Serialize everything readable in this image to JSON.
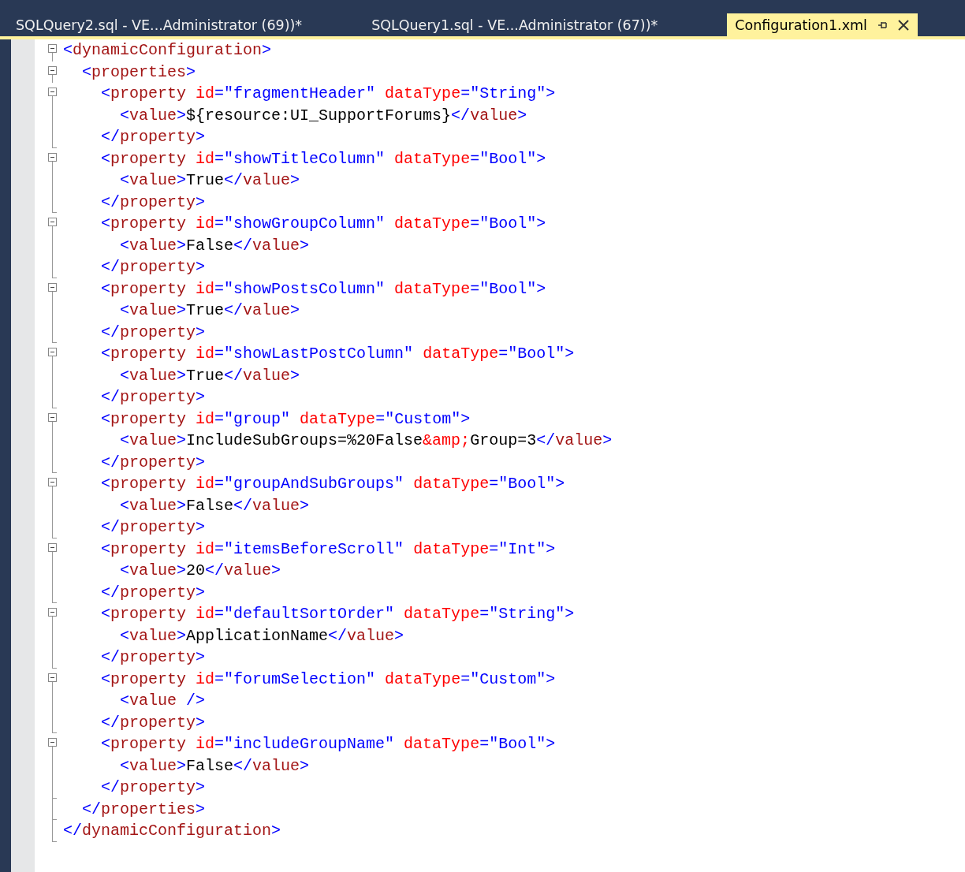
{
  "tabs": [
    {
      "label": "SQLQuery2.sql - VE...Administrator (69))*",
      "selected": false
    },
    {
      "label": "SQLQuery1.sql - VE...Administrator (67))*",
      "selected": false
    },
    {
      "label": "Configuration1.xml",
      "selected": true
    }
  ],
  "editor": {
    "lines": [
      {
        "kind": "start",
        "tokens": [
          {
            "kind": "punct",
            "text": "<"
          },
          {
            "kind": "tag",
            "text": "dynamicConfiguration"
          },
          {
            "kind": "punct",
            "text": ">"
          }
        ]
      },
      {
        "kind": "start",
        "tokens": [
          {
            "kind": "punct",
            "text": "  <"
          },
          {
            "kind": "tag",
            "text": "properties"
          },
          {
            "kind": "punct",
            "text": ">"
          }
        ]
      },
      {
        "kind": "start",
        "tokens": [
          {
            "kind": "punct",
            "text": "    <"
          },
          {
            "kind": "tag",
            "text": "property"
          },
          {
            "kind": "attr",
            "text": " id"
          },
          {
            "kind": "punct",
            "text": "=\""
          },
          {
            "kind": "value",
            "text": "fragmentHeader"
          },
          {
            "kind": "punct",
            "text": "\""
          },
          {
            "kind": "attr",
            "text": " dataType"
          },
          {
            "kind": "punct",
            "text": "=\""
          },
          {
            "kind": "value",
            "text": "String"
          },
          {
            "kind": "punct",
            "text": "\">"
          }
        ]
      },
      {
        "kind": "inner",
        "tokens": [
          {
            "kind": "punct",
            "text": "      <"
          },
          {
            "kind": "tag",
            "text": "value"
          },
          {
            "kind": "punct",
            "text": ">"
          },
          {
            "kind": "text",
            "text": "${resource:UI_SupportForums}"
          },
          {
            "kind": "punct",
            "text": "</"
          },
          {
            "kind": "tag",
            "text": "value"
          },
          {
            "kind": "punct",
            "text": ">"
          }
        ]
      },
      {
        "kind": "end",
        "tokens": [
          {
            "kind": "punct",
            "text": "    </"
          },
          {
            "kind": "tag",
            "text": "property"
          },
          {
            "kind": "punct",
            "text": ">"
          }
        ]
      },
      {
        "kind": "start",
        "tokens": [
          {
            "kind": "punct",
            "text": "    <"
          },
          {
            "kind": "tag",
            "text": "property"
          },
          {
            "kind": "attr",
            "text": " id"
          },
          {
            "kind": "punct",
            "text": "=\""
          },
          {
            "kind": "value",
            "text": "showTitleColumn"
          },
          {
            "kind": "punct",
            "text": "\""
          },
          {
            "kind": "attr",
            "text": " dataType"
          },
          {
            "kind": "punct",
            "text": "=\""
          },
          {
            "kind": "value",
            "text": "Bool"
          },
          {
            "kind": "punct",
            "text": "\">"
          }
        ]
      },
      {
        "kind": "inner",
        "tokens": [
          {
            "kind": "punct",
            "text": "      <"
          },
          {
            "kind": "tag",
            "text": "value"
          },
          {
            "kind": "punct",
            "text": ">"
          },
          {
            "kind": "text",
            "text": "True"
          },
          {
            "kind": "punct",
            "text": "</"
          },
          {
            "kind": "tag",
            "text": "value"
          },
          {
            "kind": "punct",
            "text": ">"
          }
        ]
      },
      {
        "kind": "end",
        "tokens": [
          {
            "kind": "punct",
            "text": "    </"
          },
          {
            "kind": "tag",
            "text": "property"
          },
          {
            "kind": "punct",
            "text": ">"
          }
        ]
      },
      {
        "kind": "start",
        "tokens": [
          {
            "kind": "punct",
            "text": "    <"
          },
          {
            "kind": "tag",
            "text": "property"
          },
          {
            "kind": "attr",
            "text": " id"
          },
          {
            "kind": "punct",
            "text": "=\""
          },
          {
            "kind": "value",
            "text": "showGroupColumn"
          },
          {
            "kind": "punct",
            "text": "\""
          },
          {
            "kind": "attr",
            "text": " dataType"
          },
          {
            "kind": "punct",
            "text": "=\""
          },
          {
            "kind": "value",
            "text": "Bool"
          },
          {
            "kind": "punct",
            "text": "\">"
          }
        ]
      },
      {
        "kind": "inner",
        "tokens": [
          {
            "kind": "punct",
            "text": "      <"
          },
          {
            "kind": "tag",
            "text": "value"
          },
          {
            "kind": "punct",
            "text": ">"
          },
          {
            "kind": "text",
            "text": "False"
          },
          {
            "kind": "punct",
            "text": "</"
          },
          {
            "kind": "tag",
            "text": "value"
          },
          {
            "kind": "punct",
            "text": ">"
          }
        ]
      },
      {
        "kind": "end",
        "tokens": [
          {
            "kind": "punct",
            "text": "    </"
          },
          {
            "kind": "tag",
            "text": "property"
          },
          {
            "kind": "punct",
            "text": ">"
          }
        ]
      },
      {
        "kind": "start",
        "tokens": [
          {
            "kind": "punct",
            "text": "    <"
          },
          {
            "kind": "tag",
            "text": "property"
          },
          {
            "kind": "attr",
            "text": " id"
          },
          {
            "kind": "punct",
            "text": "=\""
          },
          {
            "kind": "value",
            "text": "showPostsColumn"
          },
          {
            "kind": "punct",
            "text": "\""
          },
          {
            "kind": "attr",
            "text": " dataType"
          },
          {
            "kind": "punct",
            "text": "=\""
          },
          {
            "kind": "value",
            "text": "Bool"
          },
          {
            "kind": "punct",
            "text": "\">"
          }
        ]
      },
      {
        "kind": "inner",
        "tokens": [
          {
            "kind": "punct",
            "text": "      <"
          },
          {
            "kind": "tag",
            "text": "value"
          },
          {
            "kind": "punct",
            "text": ">"
          },
          {
            "kind": "text",
            "text": "True"
          },
          {
            "kind": "punct",
            "text": "</"
          },
          {
            "kind": "tag",
            "text": "value"
          },
          {
            "kind": "punct",
            "text": ">"
          }
        ]
      },
      {
        "kind": "end",
        "tokens": [
          {
            "kind": "punct",
            "text": "    </"
          },
          {
            "kind": "tag",
            "text": "property"
          },
          {
            "kind": "punct",
            "text": ">"
          }
        ]
      },
      {
        "kind": "start",
        "tokens": [
          {
            "kind": "punct",
            "text": "    <"
          },
          {
            "kind": "tag",
            "text": "property"
          },
          {
            "kind": "attr",
            "text": " id"
          },
          {
            "kind": "punct",
            "text": "=\""
          },
          {
            "kind": "value",
            "text": "showLastPostColumn"
          },
          {
            "kind": "punct",
            "text": "\""
          },
          {
            "kind": "attr",
            "text": " dataType"
          },
          {
            "kind": "punct",
            "text": "=\""
          },
          {
            "kind": "value",
            "text": "Bool"
          },
          {
            "kind": "punct",
            "text": "\">"
          }
        ]
      },
      {
        "kind": "inner",
        "tokens": [
          {
            "kind": "punct",
            "text": "      <"
          },
          {
            "kind": "tag",
            "text": "value"
          },
          {
            "kind": "punct",
            "text": ">"
          },
          {
            "kind": "text",
            "text": "True"
          },
          {
            "kind": "punct",
            "text": "</"
          },
          {
            "kind": "tag",
            "text": "value"
          },
          {
            "kind": "punct",
            "text": ">"
          }
        ]
      },
      {
        "kind": "end",
        "tokens": [
          {
            "kind": "punct",
            "text": "    </"
          },
          {
            "kind": "tag",
            "text": "property"
          },
          {
            "kind": "punct",
            "text": ">"
          }
        ]
      },
      {
        "kind": "start",
        "tokens": [
          {
            "kind": "punct",
            "text": "    <"
          },
          {
            "kind": "tag",
            "text": "property"
          },
          {
            "kind": "attr",
            "text": " id"
          },
          {
            "kind": "punct",
            "text": "=\""
          },
          {
            "kind": "value",
            "text": "group"
          },
          {
            "kind": "punct",
            "text": "\""
          },
          {
            "kind": "attr",
            "text": " dataType"
          },
          {
            "kind": "punct",
            "text": "=\""
          },
          {
            "kind": "value",
            "text": "Custom"
          },
          {
            "kind": "punct",
            "text": "\">"
          }
        ]
      },
      {
        "kind": "inner",
        "tokens": [
          {
            "kind": "punct",
            "text": "      <"
          },
          {
            "kind": "tag",
            "text": "value"
          },
          {
            "kind": "punct",
            "text": ">"
          },
          {
            "kind": "text",
            "text": "IncludeSubGroups=%20False"
          },
          {
            "kind": "entity",
            "text": "&amp;"
          },
          {
            "kind": "text",
            "text": "Group=3"
          },
          {
            "kind": "punct",
            "text": "</"
          },
          {
            "kind": "tag",
            "text": "value"
          },
          {
            "kind": "punct",
            "text": ">"
          }
        ]
      },
      {
        "kind": "end",
        "tokens": [
          {
            "kind": "punct",
            "text": "    </"
          },
          {
            "kind": "tag",
            "text": "property"
          },
          {
            "kind": "punct",
            "text": ">"
          }
        ]
      },
      {
        "kind": "start",
        "tokens": [
          {
            "kind": "punct",
            "text": "    <"
          },
          {
            "kind": "tag",
            "text": "property"
          },
          {
            "kind": "attr",
            "text": " id"
          },
          {
            "kind": "punct",
            "text": "=\""
          },
          {
            "kind": "value",
            "text": "groupAndSubGroups"
          },
          {
            "kind": "punct",
            "text": "\""
          },
          {
            "kind": "attr",
            "text": " dataType"
          },
          {
            "kind": "punct",
            "text": "=\""
          },
          {
            "kind": "value",
            "text": "Bool"
          },
          {
            "kind": "punct",
            "text": "\">"
          }
        ]
      },
      {
        "kind": "inner",
        "tokens": [
          {
            "kind": "punct",
            "text": "      <"
          },
          {
            "kind": "tag",
            "text": "value"
          },
          {
            "kind": "punct",
            "text": ">"
          },
          {
            "kind": "text",
            "text": "False"
          },
          {
            "kind": "punct",
            "text": "</"
          },
          {
            "kind": "tag",
            "text": "value"
          },
          {
            "kind": "punct",
            "text": ">"
          }
        ]
      },
      {
        "kind": "end",
        "tokens": [
          {
            "kind": "punct",
            "text": "    </"
          },
          {
            "kind": "tag",
            "text": "property"
          },
          {
            "kind": "punct",
            "text": ">"
          }
        ]
      },
      {
        "kind": "start",
        "tokens": [
          {
            "kind": "punct",
            "text": "    <"
          },
          {
            "kind": "tag",
            "text": "property"
          },
          {
            "kind": "attr",
            "text": " id"
          },
          {
            "kind": "punct",
            "text": "=\""
          },
          {
            "kind": "value",
            "text": "itemsBeforeScroll"
          },
          {
            "kind": "punct",
            "text": "\""
          },
          {
            "kind": "attr",
            "text": " dataType"
          },
          {
            "kind": "punct",
            "text": "=\""
          },
          {
            "kind": "value",
            "text": "Int"
          },
          {
            "kind": "punct",
            "text": "\">"
          }
        ]
      },
      {
        "kind": "inner",
        "tokens": [
          {
            "kind": "punct",
            "text": "      <"
          },
          {
            "kind": "tag",
            "text": "value"
          },
          {
            "kind": "punct",
            "text": ">"
          },
          {
            "kind": "text",
            "text": "20"
          },
          {
            "kind": "punct",
            "text": "</"
          },
          {
            "kind": "tag",
            "text": "value"
          },
          {
            "kind": "punct",
            "text": ">"
          }
        ]
      },
      {
        "kind": "end",
        "tokens": [
          {
            "kind": "punct",
            "text": "    </"
          },
          {
            "kind": "tag",
            "text": "property"
          },
          {
            "kind": "punct",
            "text": ">"
          }
        ]
      },
      {
        "kind": "start",
        "tokens": [
          {
            "kind": "punct",
            "text": "    <"
          },
          {
            "kind": "tag",
            "text": "property"
          },
          {
            "kind": "attr",
            "text": " id"
          },
          {
            "kind": "punct",
            "text": "=\""
          },
          {
            "kind": "value",
            "text": "defaultSortOrder"
          },
          {
            "kind": "punct",
            "text": "\""
          },
          {
            "kind": "attr",
            "text": " dataType"
          },
          {
            "kind": "punct",
            "text": "=\""
          },
          {
            "kind": "value",
            "text": "String"
          },
          {
            "kind": "punct",
            "text": "\">"
          }
        ]
      },
      {
        "kind": "inner",
        "tokens": [
          {
            "kind": "punct",
            "text": "      <"
          },
          {
            "kind": "tag",
            "text": "value"
          },
          {
            "kind": "punct",
            "text": ">"
          },
          {
            "kind": "text",
            "text": "ApplicationName"
          },
          {
            "kind": "punct",
            "text": "</"
          },
          {
            "kind": "tag",
            "text": "value"
          },
          {
            "kind": "punct",
            "text": ">"
          }
        ]
      },
      {
        "kind": "end",
        "tokens": [
          {
            "kind": "punct",
            "text": "    </"
          },
          {
            "kind": "tag",
            "text": "property"
          },
          {
            "kind": "punct",
            "text": ">"
          }
        ]
      },
      {
        "kind": "start",
        "tokens": [
          {
            "kind": "punct",
            "text": "    <"
          },
          {
            "kind": "tag",
            "text": "property"
          },
          {
            "kind": "attr",
            "text": " id"
          },
          {
            "kind": "punct",
            "text": "=\""
          },
          {
            "kind": "value",
            "text": "forumSelection"
          },
          {
            "kind": "punct",
            "text": "\""
          },
          {
            "kind": "attr",
            "text": " dataType"
          },
          {
            "kind": "punct",
            "text": "=\""
          },
          {
            "kind": "value",
            "text": "Custom"
          },
          {
            "kind": "punct",
            "text": "\">"
          }
        ]
      },
      {
        "kind": "inner",
        "tokens": [
          {
            "kind": "punct",
            "text": "      <"
          },
          {
            "kind": "tag",
            "text": "value"
          },
          {
            "kind": "punct",
            "text": " />"
          }
        ]
      },
      {
        "kind": "end",
        "tokens": [
          {
            "kind": "punct",
            "text": "    </"
          },
          {
            "kind": "tag",
            "text": "property"
          },
          {
            "kind": "punct",
            "text": ">"
          }
        ]
      },
      {
        "kind": "start",
        "tokens": [
          {
            "kind": "punct",
            "text": "    <"
          },
          {
            "kind": "tag",
            "text": "property"
          },
          {
            "kind": "attr",
            "text": " id"
          },
          {
            "kind": "punct",
            "text": "=\""
          },
          {
            "kind": "value",
            "text": "includeGroupName"
          },
          {
            "kind": "punct",
            "text": "\""
          },
          {
            "kind": "attr",
            "text": " dataType"
          },
          {
            "kind": "punct",
            "text": "=\""
          },
          {
            "kind": "value",
            "text": "Bool"
          },
          {
            "kind": "punct",
            "text": "\">"
          }
        ]
      },
      {
        "kind": "inner",
        "tokens": [
          {
            "kind": "punct",
            "text": "      <"
          },
          {
            "kind": "tag",
            "text": "value"
          },
          {
            "kind": "punct",
            "text": ">"
          },
          {
            "kind": "text",
            "text": "False"
          },
          {
            "kind": "punct",
            "text": "</"
          },
          {
            "kind": "tag",
            "text": "value"
          },
          {
            "kind": "punct",
            "text": ">"
          }
        ]
      },
      {
        "kind": "end",
        "tokens": [
          {
            "kind": "punct",
            "text": "    </"
          },
          {
            "kind": "tag",
            "text": "property"
          },
          {
            "kind": "punct",
            "text": ">"
          }
        ]
      },
      {
        "kind": "end",
        "tokens": [
          {
            "kind": "punct",
            "text": "  </"
          },
          {
            "kind": "tag",
            "text": "properties"
          },
          {
            "kind": "punct",
            "text": ">"
          }
        ]
      },
      {
        "kind": "end",
        "tokens": [
          {
            "kind": "punct",
            "text": "</"
          },
          {
            "kind": "tag",
            "text": "dynamicConfiguration"
          },
          {
            "kind": "punct",
            "text": ">"
          }
        ]
      }
    ]
  }
}
